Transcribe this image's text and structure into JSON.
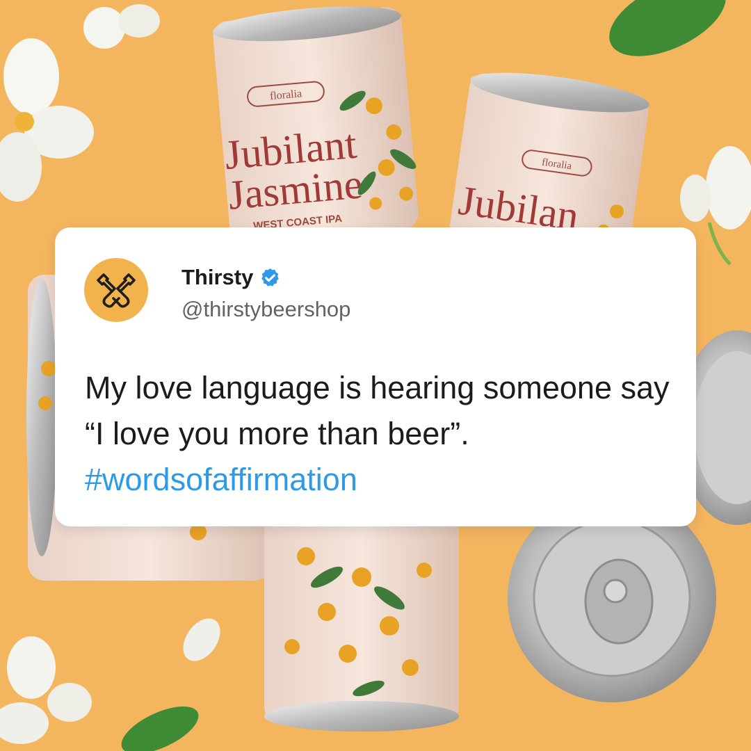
{
  "background": {
    "color": "#f4b55f",
    "can_brand": "floralia",
    "can_name_line1": "Jubilant",
    "can_name_line2": "Jasmine",
    "can_style": "WEST COAST IPA",
    "partial_can_name": "Jubilan"
  },
  "tweet": {
    "display_name": "Thirsty",
    "verified": true,
    "handle": "@thirstybeershop",
    "text_main": "My love language is hearing someone say “I love you more than beer”.",
    "hashtag": "#wordsofaffirmation",
    "colors": {
      "hashtag": "#2d9ae8",
      "avatar_bg": "#f3b34c",
      "verified_badge": "#2d9ae8"
    }
  }
}
